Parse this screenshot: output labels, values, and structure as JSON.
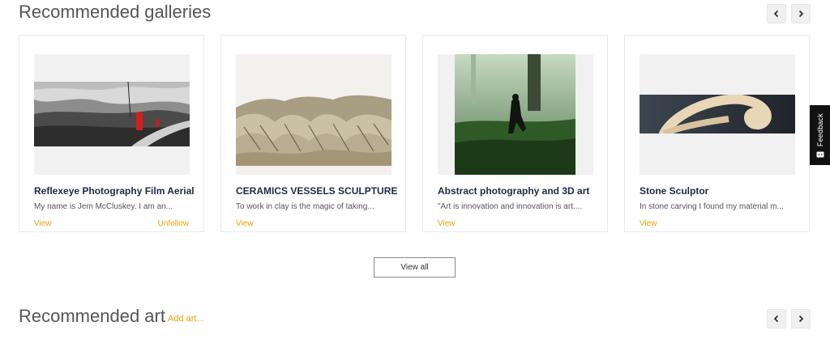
{
  "sections": {
    "galleries_title": "Recommended galleries",
    "art_title": "Recommended art",
    "add_art_label": "Add art..."
  },
  "galleries": [
    {
      "title": "Reflexeye Photography Film Aerial",
      "description": "My name is Jem McCluskey. I am an...",
      "view_label": "View",
      "unfollow_label": "Unfollow"
    },
    {
      "title": "CERAMICS VESSELS SCULPTURES",
      "description": "To work in clay is the magic of taking...",
      "view_label": "View"
    },
    {
      "title": "Abstract photography and 3D art",
      "description": "\"Art is innovation and innovation is art....",
      "view_label": "View"
    },
    {
      "title": "Stone Sculptor",
      "description": "In stone carving I found my material m...",
      "view_label": "View"
    }
  ],
  "view_all_label": "View all",
  "feedback_label": "Feedback",
  "icons": {
    "prev": "chevron-left-icon",
    "next": "chevron-right-icon",
    "feedback": "feedback-icon"
  },
  "colors": {
    "accent": "#e2a400",
    "heading": "#555555",
    "card_title": "#1f2a44",
    "feedback_bg": "#111111"
  }
}
